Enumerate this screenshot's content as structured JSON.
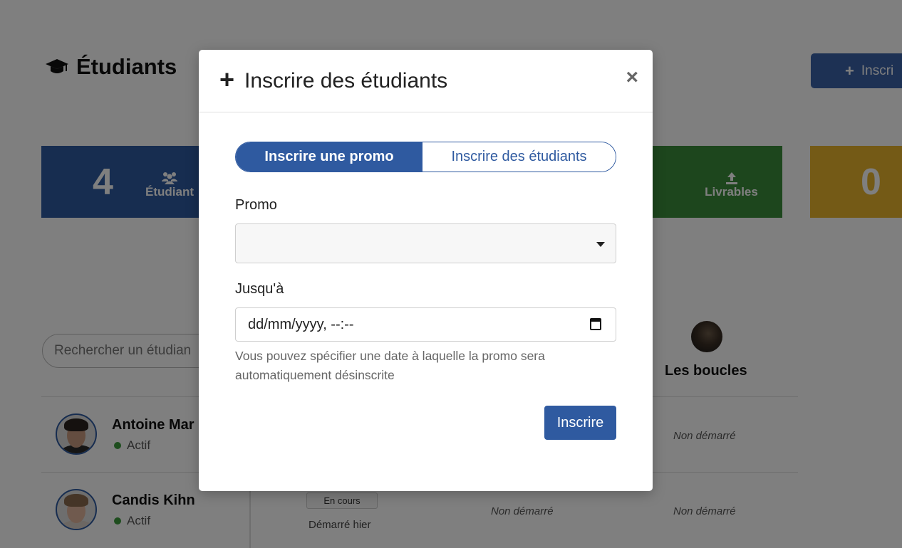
{
  "page": {
    "title": "Étudiants",
    "top_button_label": "Inscri",
    "stats": {
      "students_count": "4",
      "students_label": "Étudiant",
      "livrables_label": "Livrables",
      "yellow_count": "0"
    },
    "search_placeholder": "Rechercher un étudian",
    "column_title": "Les boucles",
    "students": [
      {
        "name": "Antoine Mar",
        "status": "Actif",
        "boucles": "Non démarré"
      },
      {
        "name": "Candis Kihn",
        "status": "Actif",
        "badge": "En cours",
        "started": "Démarré hier",
        "col3": "Non démarré",
        "boucles": "Non démarré"
      }
    ]
  },
  "modal": {
    "title": "Inscrire des étudiants",
    "tabs": [
      {
        "label": "Inscrire une promo",
        "active": true
      },
      {
        "label": "Inscrire des étudiants",
        "active": false
      }
    ],
    "promo_label": "Promo",
    "promo_value": "",
    "until_label": "Jusqu'à",
    "until_placeholder": "dd/mm/yyyy, --:--",
    "help_text": "Vous pouvez spécifier une date à laquelle la promo sera automatiquement désinscrite",
    "submit_label": "Inscrire"
  },
  "colors": {
    "primary": "#2f5aa0",
    "green": "#3b8c3b",
    "yellow": "#e8b52c",
    "status_active": "#3c9a3c"
  },
  "icons": {
    "title": "graduation-cap-icon",
    "students_stat": "users-icon",
    "livrables_stat": "upload-icon",
    "modal_title": "plus-icon",
    "close": "close-icon",
    "select": "caret-down-icon",
    "date": "calendar-icon"
  }
}
